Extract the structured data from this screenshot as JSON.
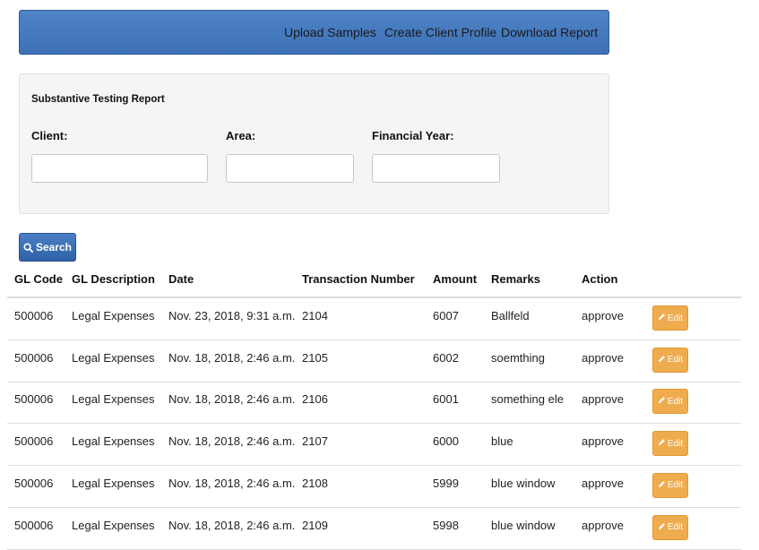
{
  "nav": {
    "links": [
      "Upload Samples",
      "Create Client Profile",
      "Download Report"
    ]
  },
  "panel": {
    "title": "Substantive Testing Report",
    "client_label": "Client:",
    "area_label": "Area:",
    "year_label": "Financial Year:",
    "client_value": "",
    "area_value": "",
    "year_value": ""
  },
  "search_button": {
    "label": "Search",
    "icon": "search-icon"
  },
  "table": {
    "headers": [
      "GL Code",
      "GL Description",
      "Date",
      "Transaction Number",
      "Amount",
      "Remarks",
      "Action"
    ],
    "edit_label": "Edit",
    "edit_icon": "pencil-icon",
    "rows": [
      [
        "500006",
        "Legal Expenses",
        "Nov. 23, 2018, 9:31 a.m.",
        "2104",
        "6007",
        "Ballfeld",
        "approve"
      ],
      [
        "500006",
        "Legal Expenses",
        "Nov. 18, 2018, 2:46 a.m.",
        "2105",
        "6002",
        "soemthing",
        "approve"
      ],
      [
        "500006",
        "Legal Expenses",
        "Nov. 18, 2018, 2:46 a.m.",
        "2106",
        "6001",
        "something ele",
        "approve"
      ],
      [
        "500006",
        "Legal Expenses",
        "Nov. 18, 2018, 2:46 a.m.",
        "2107",
        "6000",
        "blue",
        "approve"
      ],
      [
        "500006",
        "Legal Expenses",
        "Nov. 18, 2018, 2:46 a.m.",
        "2108",
        "5999",
        "blue window",
        "approve"
      ],
      [
        "500006",
        "Legal Expenses",
        "Nov. 18, 2018, 2:46 a.m.",
        "2109",
        "5998",
        "blue window",
        "approve"
      ]
    ]
  },
  "colors": {
    "navbar": "#4379bd",
    "primary_button": "#3a6db0",
    "edit_button": "#efac4e",
    "panel_background": "#f5f5f5"
  }
}
